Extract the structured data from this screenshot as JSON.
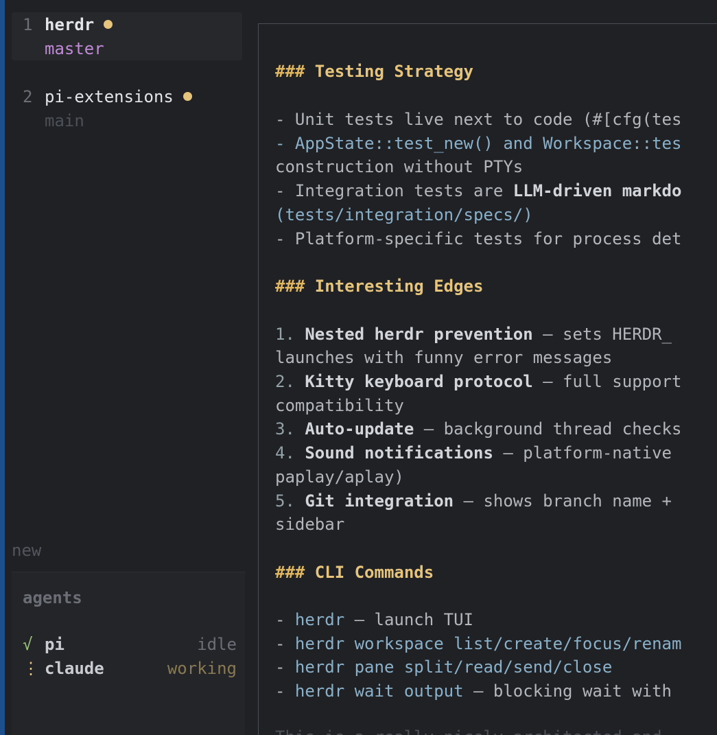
{
  "sidebar": {
    "workspaces": [
      {
        "num": "1",
        "name": "herdr",
        "branch": "master"
      },
      {
        "num": "2",
        "name": "pi-extensions",
        "branch": "main"
      }
    ],
    "new_label": "new",
    "agents_title": "agents",
    "agents": [
      {
        "icon": "√",
        "name": "pi",
        "status": "idle"
      },
      {
        "icon": "⋮",
        "name": "claude",
        "status": "working"
      }
    ]
  },
  "doc": {
    "h_testing": "Testing Strategy",
    "testing_1": "- Unit tests live next to code (#[cfg(tes",
    "testing_2": "- AppState::test_new() and Workspace::tes",
    "testing_3": "construction without PTYs",
    "testing_4_pre": "- Integration tests are ",
    "testing_4_bold": "LLM-driven markdo",
    "testing_5": "(tests/integration/specs/)",
    "testing_6": "- Platform-specific tests for process det",
    "h_edges": "Interesting Edges",
    "edges": [
      {
        "n": "1. ",
        "title": "Nested herdr prevention",
        "rest": " — sets HERDR_",
        "cont": "launches with funny error messages"
      },
      {
        "n": "2. ",
        "title": "Kitty keyboard protocol",
        "rest": " — full support",
        "cont": "compatibility"
      },
      {
        "n": "3. ",
        "title": "Auto-update",
        "rest": " — background thread checks",
        "cont": ""
      },
      {
        "n": "4. ",
        "title": "Sound notifications",
        "rest": " — platform-native",
        "cont": "paplay/aplay)"
      },
      {
        "n": "5. ",
        "title": "Git integration",
        "rest": " — shows branch name +",
        "cont": "sidebar"
      }
    ],
    "h_cli": "CLI Commands",
    "cli_1_cmd": "herdr",
    "cli_1_rest": " — launch TUI",
    "cli_2": "herdr workspace list/create/focus/renam",
    "cli_3": "herdr pane split/read/send/close",
    "cli_4_cmd": "herdr wait output",
    "cli_4_rest": " — blocking wait with",
    "cut_off": "This is a really nicely architected and"
  }
}
